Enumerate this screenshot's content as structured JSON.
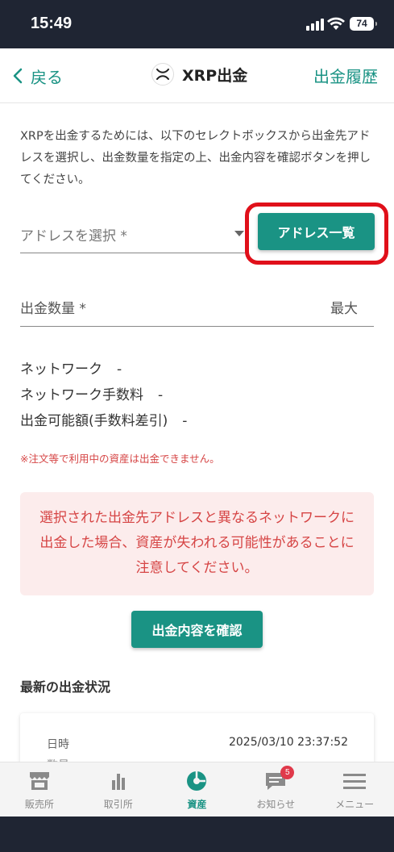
{
  "status_bar": {
    "time": "15:49",
    "battery": "74"
  },
  "header": {
    "back_label": "戻る",
    "title": "XRP出金",
    "history_label": "出金履歴"
  },
  "intro_text": "XRPを出金するためには、以下のセレクトボックスから出金先アドレスを選択し、出金数量を指定の上、出金内容を確認ボタンを押してください。",
  "address": {
    "select_label": "アドレスを選択 *",
    "list_button": "アドレス一覧"
  },
  "amount": {
    "label": "出金数量 *",
    "max_label": "最大"
  },
  "info": {
    "network_label": "ネットワーク",
    "network_value": "-",
    "fee_label": "ネットワーク手数料",
    "fee_value": "-",
    "available_label": "出金可能額(手数料差引)",
    "available_value": "-"
  },
  "notice_small": "※注文等で利用中の資産は出金できません。",
  "warning_text": "選択された出金先アドレスと異なるネットワークに出金した場合、資産が失われる可能性があることに注意してください。",
  "confirm_button": "出金内容を確認",
  "latest_section": {
    "title": "最新の出金状況",
    "date_label": "日時",
    "date_value": "2025/03/10 23:37:52",
    "next_label": "数量"
  },
  "tabs": [
    {
      "label": "販売所",
      "icon": "store-icon"
    },
    {
      "label": "取引所",
      "icon": "bar-chart-icon"
    },
    {
      "label": "資産",
      "icon": "pie-chart-icon",
      "active": true
    },
    {
      "label": "お知らせ",
      "icon": "message-icon",
      "badge": "5"
    },
    {
      "label": "メニュー",
      "icon": "menu-icon"
    }
  ],
  "colors": {
    "accent": "#1a9384",
    "highlight": "#e0101a",
    "warning_bg": "#fcecec",
    "warning_text": "#d64545",
    "status_bar": "#1f2533"
  }
}
